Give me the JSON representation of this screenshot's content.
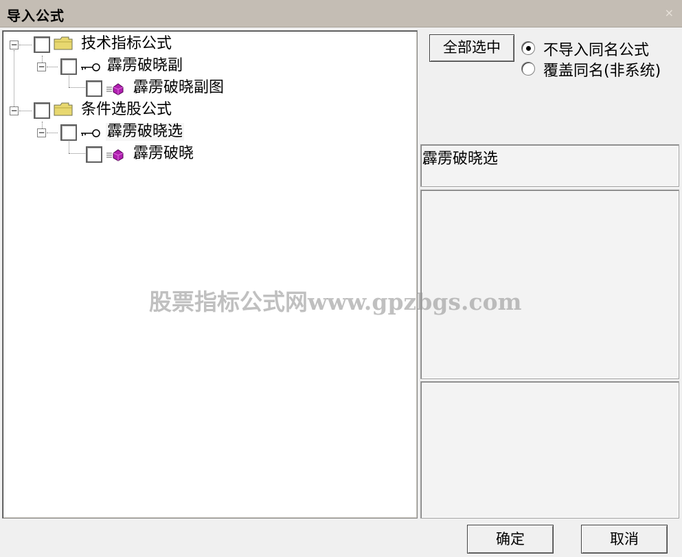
{
  "window": {
    "title": "导入公式",
    "close_glyph": "×"
  },
  "tree": {
    "nodes": [
      {
        "label": "技术指标公式",
        "type": "folder",
        "expander": "−"
      },
      {
        "label": "霹雳破晓副",
        "type": "key",
        "expander": "−"
      },
      {
        "label": "霹雳破晓副图",
        "type": "gem"
      },
      {
        "label": "条件选股公式",
        "type": "folder",
        "expander": "−"
      },
      {
        "label": "霹雳破晓选",
        "type": "key",
        "expander": "−"
      },
      {
        "label": "霹雳破晓",
        "type": "gem"
      }
    ]
  },
  "right": {
    "select_all_label": "全部选中",
    "options": [
      {
        "label": "不导入同名公式",
        "checked": true
      },
      {
        "label": "覆盖同名(非系统)",
        "checked": false
      }
    ],
    "selected_name": "霹雳破晓选"
  },
  "footer": {
    "ok_label": "确定",
    "cancel_label": "取消"
  },
  "watermark": "股票指标公式网www.gpzbgs.com",
  "colors": {
    "titlebar": "#c4bdb4",
    "folder": "#e8d870",
    "gem": "#b020b0"
  }
}
